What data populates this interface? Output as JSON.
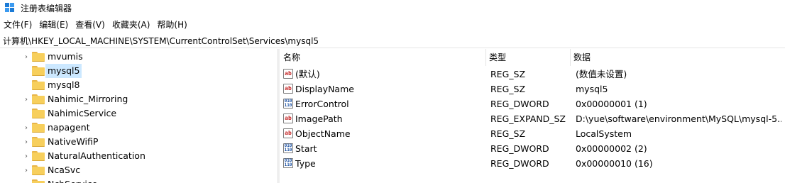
{
  "window": {
    "title": "注册表编辑器",
    "icon": "registry-icon"
  },
  "menu": [
    "文件(F)",
    "编辑(E)",
    "查看(V)",
    "收藏夹(A)",
    "帮助(H)"
  ],
  "address": "计算机\\HKEY_LOCAL_MACHINE\\SYSTEM\\CurrentControlSet\\Services\\mysql5",
  "tree": [
    {
      "label": "mvumis",
      "expandable": true,
      "selected": false
    },
    {
      "label": "mysql5",
      "expandable": false,
      "selected": true
    },
    {
      "label": "mysql8",
      "expandable": false,
      "selected": false
    },
    {
      "label": "Nahimic_Mirroring",
      "expandable": true,
      "selected": false
    },
    {
      "label": "NahimicService",
      "expandable": false,
      "selected": false
    },
    {
      "label": "napagent",
      "expandable": true,
      "selected": false
    },
    {
      "label": "NativeWifiP",
      "expandable": true,
      "selected": false
    },
    {
      "label": "NaturalAuthentication",
      "expandable": true,
      "selected": false
    },
    {
      "label": "NcaSvc",
      "expandable": true,
      "selected": false
    },
    {
      "label": "NcbService",
      "expandable": true,
      "selected": false
    }
  ],
  "columns": {
    "name": "名称",
    "type": "类型",
    "data": "数据"
  },
  "values": [
    {
      "icon": "string-value-icon",
      "name": "(默认)",
      "type": "REG_SZ",
      "data": "(数值未设置)"
    },
    {
      "icon": "string-value-icon",
      "name": "DisplayName",
      "type": "REG_SZ",
      "data": "mysql5"
    },
    {
      "icon": "binary-value-icon",
      "name": "ErrorControl",
      "type": "REG_DWORD",
      "data": "0x00000001 (1)"
    },
    {
      "icon": "string-value-icon",
      "name": "ImagePath",
      "type": "REG_EXPAND_SZ",
      "data": "D:\\yue\\software\\environment\\MySQL\\mysql-5..."
    },
    {
      "icon": "string-value-icon",
      "name": "ObjectName",
      "type": "REG_SZ",
      "data": "LocalSystem"
    },
    {
      "icon": "binary-value-icon",
      "name": "Start",
      "type": "REG_DWORD",
      "data": "0x00000002 (2)"
    },
    {
      "icon": "binary-value-icon",
      "name": "Type",
      "type": "REG_DWORD",
      "data": "0x00000010 (16)"
    }
  ],
  "colors": {
    "selection": "#cce8ff",
    "folder": "#f7cf5c",
    "accent": "#1c7bd6"
  }
}
